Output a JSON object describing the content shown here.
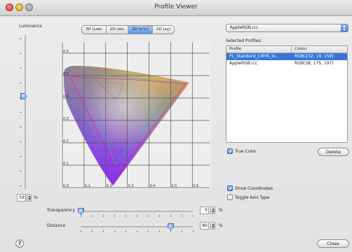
{
  "window": {
    "title": "Profile Viewer"
  },
  "luminance": {
    "label": "Luminance",
    "value": "59",
    "unit": "%"
  },
  "tabs": [
    {
      "label": "3D (Lab)",
      "active": false
    },
    {
      "label": "2D (ab)",
      "active": false
    },
    {
      "label": "2D (u'v')",
      "active": true
    },
    {
      "label": "2D (xy)",
      "active": false
    }
  ],
  "plot": {
    "x_ticks": [
      "0.0",
      "0.1",
      "0.2",
      "0.3",
      "0.4",
      "0.5",
      "0.6"
    ],
    "y_ticks": [
      "0.1",
      "0.2",
      "0.3",
      "0.4",
      "0.5",
      "0.6"
    ]
  },
  "transparency": {
    "label": "Transparency",
    "value": "0",
    "unit": "%",
    "level_percent": 0
  },
  "distance": {
    "label": "Distance",
    "value": "80",
    "unit": "%",
    "level_percent": 80
  },
  "profile_popup": {
    "selected": "AppleRGB.icc"
  },
  "selected_profiles": {
    "label": "Selected Profiles:",
    "columns": [
      "Profile",
      "Colour"
    ],
    "rows": [
      {
        "profile": "PL_Standard_CMYK_In...",
        "colour": "RGB(232, 19, 158)",
        "selected": true
      },
      {
        "profile": "AppleRGB.icc",
        "colour": "RGB(38, 175, 197)",
        "selected": false
      }
    ]
  },
  "true_color": {
    "label": "True Color",
    "checked": true
  },
  "delete_button": {
    "label": "Delete"
  },
  "show_coordinates": {
    "label": "Show Coordinates",
    "checked": true
  },
  "toggle_axis": {
    "label": "Toggle Axis Type",
    "checked": false
  },
  "close_button": {
    "label": "Close"
  },
  "help_button": {
    "label": "?"
  },
  "colors": {
    "accent": "#3875d7",
    "grid": "#555555",
    "outline_profile_1": "#e8139e",
    "outline_profile_2": "#26afc5"
  }
}
